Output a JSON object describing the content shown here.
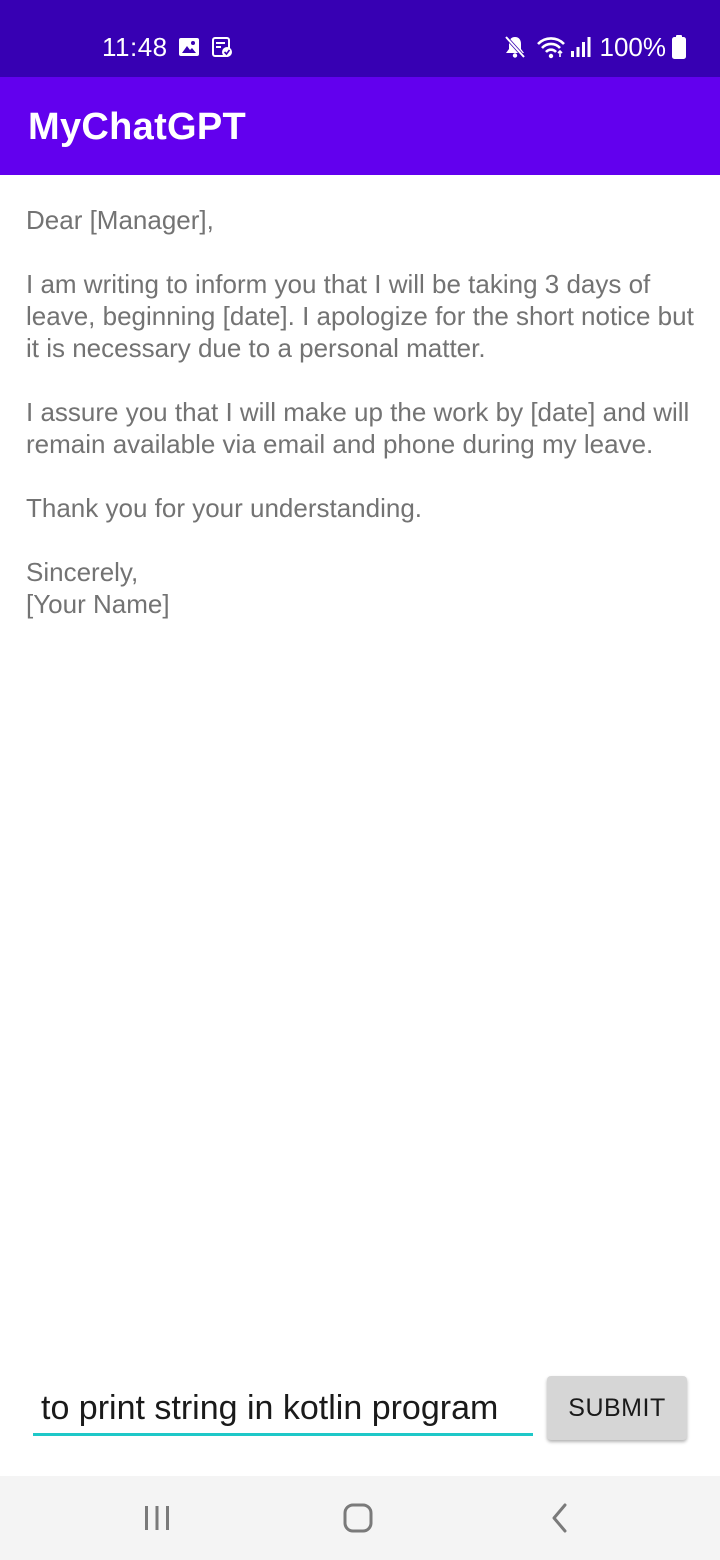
{
  "status_bar": {
    "time": "11:48",
    "battery_percent": "100%",
    "icons": [
      "image-icon",
      "screenshot-icon",
      "mute-icon",
      "wifi-icon",
      "signal-icon",
      "battery-icon"
    ],
    "background": "#3700b3"
  },
  "app_bar": {
    "title": "MyChatGPT",
    "background": "#6200ee"
  },
  "response": {
    "greeting": "Dear [Manager],",
    "paragraph1": "I am writing to inform you that I will be taking 3 days of leave, beginning [date]. I apologize for the short notice but it is necessary due to a personal matter.",
    "paragraph2": "I assure you that I will make up the work by [date] and will remain available via email and phone during my leave.",
    "paragraph3": "Thank you for your understanding.",
    "closing": "Sincerely,",
    "signature": "[Your Name]"
  },
  "input": {
    "value": "to print string in kotlin program",
    "underline_color": "#1ec8c8"
  },
  "submit": {
    "label": "SUBMIT"
  },
  "nav_bar": {
    "icons": [
      "recent-apps-icon",
      "home-icon",
      "back-icon"
    ]
  }
}
